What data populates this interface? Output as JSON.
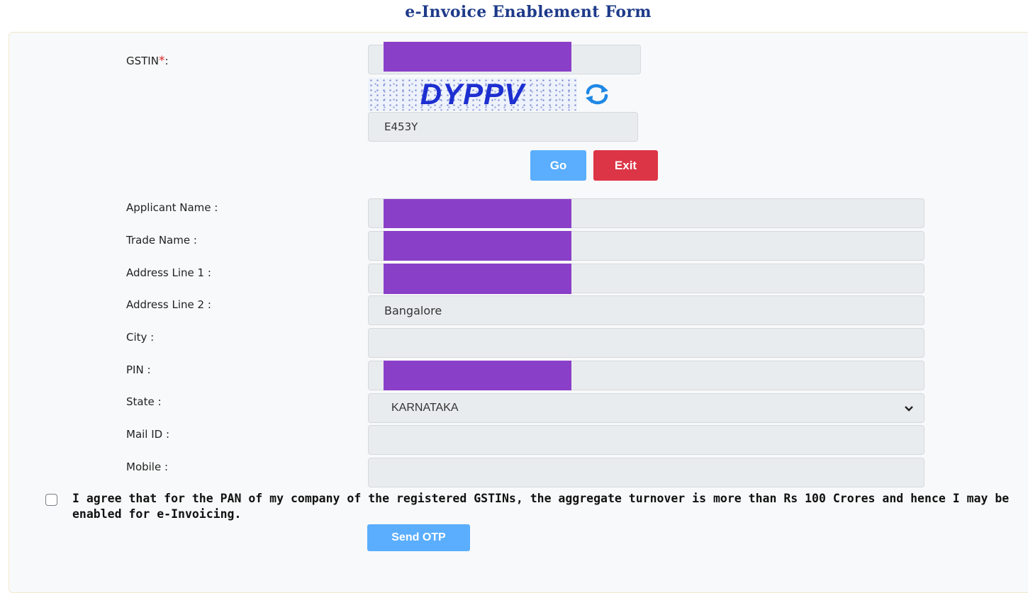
{
  "page": {
    "title": "e-Invoice Enablement Form"
  },
  "colors": {
    "title": "#1e3a8a",
    "primary_button": "#5aaefd",
    "danger_button": "#dc3545",
    "required": "#e02424",
    "redaction": "#8a3fc8"
  },
  "gstin": {
    "label": "GSTIN",
    "required_mark": "*",
    "suffix": ":"
  },
  "captcha": {
    "text": "DYPPV",
    "input_value": "E453Y",
    "refresh_icon": "refresh-icon"
  },
  "buttons": {
    "go": "Go",
    "exit": "Exit",
    "send_otp": "Send OTP"
  },
  "fields": {
    "applicant_name": {
      "label": "Applicant Name :"
    },
    "trade_name": {
      "label": "Trade Name :"
    },
    "address1": {
      "label": "Address Line 1 :"
    },
    "address2": {
      "label": "Address Line 2 :",
      "value": "Bangalore"
    },
    "city": {
      "label": "City :"
    },
    "pin": {
      "label": "PIN :"
    },
    "state": {
      "label": "State :",
      "value": "KARNATAKA",
      "icon": "chevron-down-icon"
    },
    "mail": {
      "label": "Mail ID :"
    },
    "mobile": {
      "label": "Mobile :"
    }
  },
  "agreement": {
    "text": "I agree that for the PAN of my company of the registered GSTINs, the aggregate turnover is more than Rs 100 Crores and hence I may be enabled for e-Invoicing.",
    "checked": false
  }
}
